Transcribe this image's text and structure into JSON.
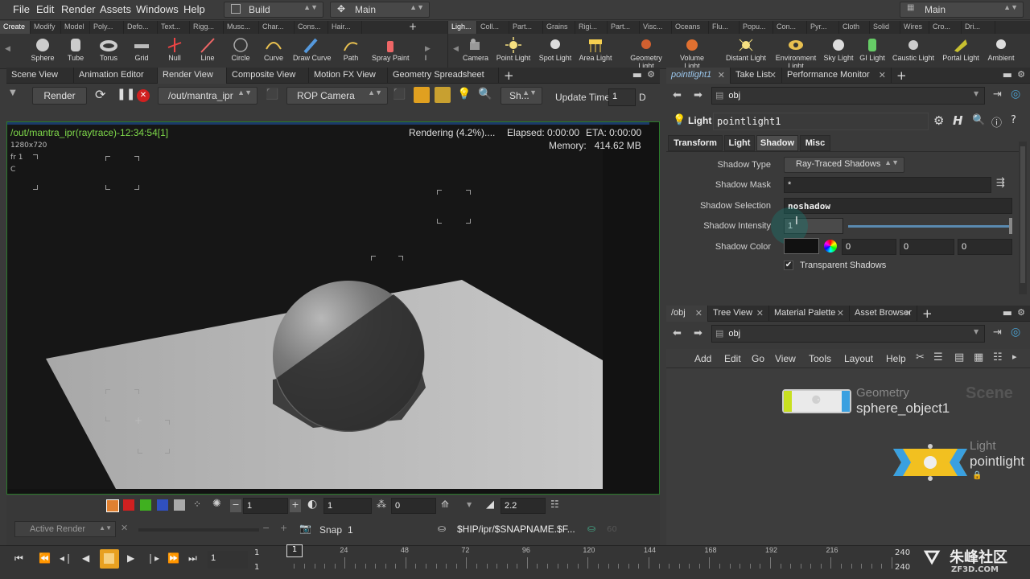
{
  "menubar": {
    "items": [
      "File",
      "Edit",
      "Render",
      "Assets",
      "Windows",
      "Help"
    ],
    "desktop": "Build",
    "main": "Main",
    "main_right": "Main"
  },
  "shelf_left": {
    "tabs": [
      "Create",
      "Modify",
      "Model",
      "Poly...",
      "Defo...",
      "Text...",
      "Rigg...",
      "Musc...",
      "Char...",
      "Cons...",
      "Hair..."
    ],
    "tools": [
      "Sphere",
      "Tube",
      "Torus",
      "Grid",
      "Null",
      "Line",
      "Circle",
      "Curve",
      "Draw Curve",
      "Path",
      "Spray Paint",
      "I"
    ]
  },
  "shelf_right": {
    "tabs": [
      "Ligh...",
      "Coll...",
      "Part...",
      "Grains",
      "Rigi...",
      "Part...",
      "Visc...",
      "Oceans",
      "Flu...",
      "Popu...",
      "Con...",
      "Pyr...",
      "Cloth",
      "Solid",
      "Wires",
      "Cro...",
      "Dri..."
    ],
    "tools": [
      "Camera",
      "Point Light",
      "Spot Light",
      "Area Light",
      "Geometry Light",
      "Volume Light",
      "Distant Light",
      "Environment Light",
      "Sky Light",
      "GI Light",
      "Caustic Light",
      "Portal Light",
      "Ambient"
    ]
  },
  "left_tabs": [
    "Scene View",
    "Animation Editor",
    "Render View",
    "Composite View",
    "Motion FX View",
    "Geometry Spreadsheet"
  ],
  "render_toolbar": {
    "render_label": "Render",
    "rop_path": "/out/mantra_ipr",
    "camera": "ROP Camera",
    "sh": "Sh...",
    "update_time_label": "Update Time",
    "update_time_value": "1",
    "d": "D"
  },
  "viewport": {
    "title": "/out/mantra_ipr(raytrace)-12:34:54[1]",
    "resolution": "1280x720",
    "frame": "fr 1",
    "channel": "C",
    "status": "Rendering (4.2%)....",
    "elapsed": "Elapsed: 0:00:00",
    "eta": "ETA: 0:00:00",
    "memory": "Memory:   414.62 MB"
  },
  "render_bottom": {
    "num1": "1",
    "num2": "1",
    "num3": "0",
    "gamma": "2.2",
    "active_render": "Active Render",
    "snap": "Snap",
    "snap_value": "1",
    "path": "$HIP/ipr/$SNAPNAME.$F...",
    "faint": "60"
  },
  "right_tabs": [
    "pointlight1",
    "Take List",
    "Performance Monitor"
  ],
  "params": {
    "path": "obj",
    "node_type": "Light",
    "node_name": "pointlight1",
    "tabs": [
      "Transform",
      "Light",
      "Shadow",
      "Misc"
    ],
    "shadow_type_label": "Shadow Type",
    "shadow_type_value": "Ray-Traced Shadows",
    "shadow_mask_label": "Shadow Mask",
    "shadow_mask_value": "*",
    "shadow_selection_label": "Shadow Selection",
    "shadow_selection_value": "noshadow",
    "shadow_intensity_label": "Shadow Intensity",
    "shadow_intensity_value": "1",
    "shadow_intensity_slider": 1.0,
    "shadow_color_label": "Shadow Color",
    "shadow_color_r": "0",
    "shadow_color_g": "0",
    "shadow_color_b": "0",
    "transparent_label": "Transparent Shadows",
    "transparent_checked": true
  },
  "net_tabs": [
    "/obj",
    "Tree View",
    "Material Palette",
    "Asset Browser"
  ],
  "network": {
    "path": "obj",
    "menu": [
      "Add",
      "Edit",
      "Go",
      "View",
      "Tools",
      "Layout",
      "Help"
    ],
    "watermark": "Scene",
    "node1_type": "Geometry",
    "node1_name": "sphere_object1",
    "node2_type": "Light",
    "node2_name": "pointlight"
  },
  "timeline": {
    "frame": "1",
    "start": "1",
    "start2": "1",
    "current": "1",
    "ticks": [
      "24",
      "48",
      "72",
      "96",
      "120",
      "144",
      "168",
      "192",
      "216"
    ],
    "end": "240",
    "end2": "240",
    "logo_text": "朱峰社区",
    "logo_url": "ZF3D.COM"
  },
  "colors": {
    "accent_green": "#7ed84a",
    "viewport_border": "#2a7a2a",
    "active_yellow": "#f5d020"
  }
}
